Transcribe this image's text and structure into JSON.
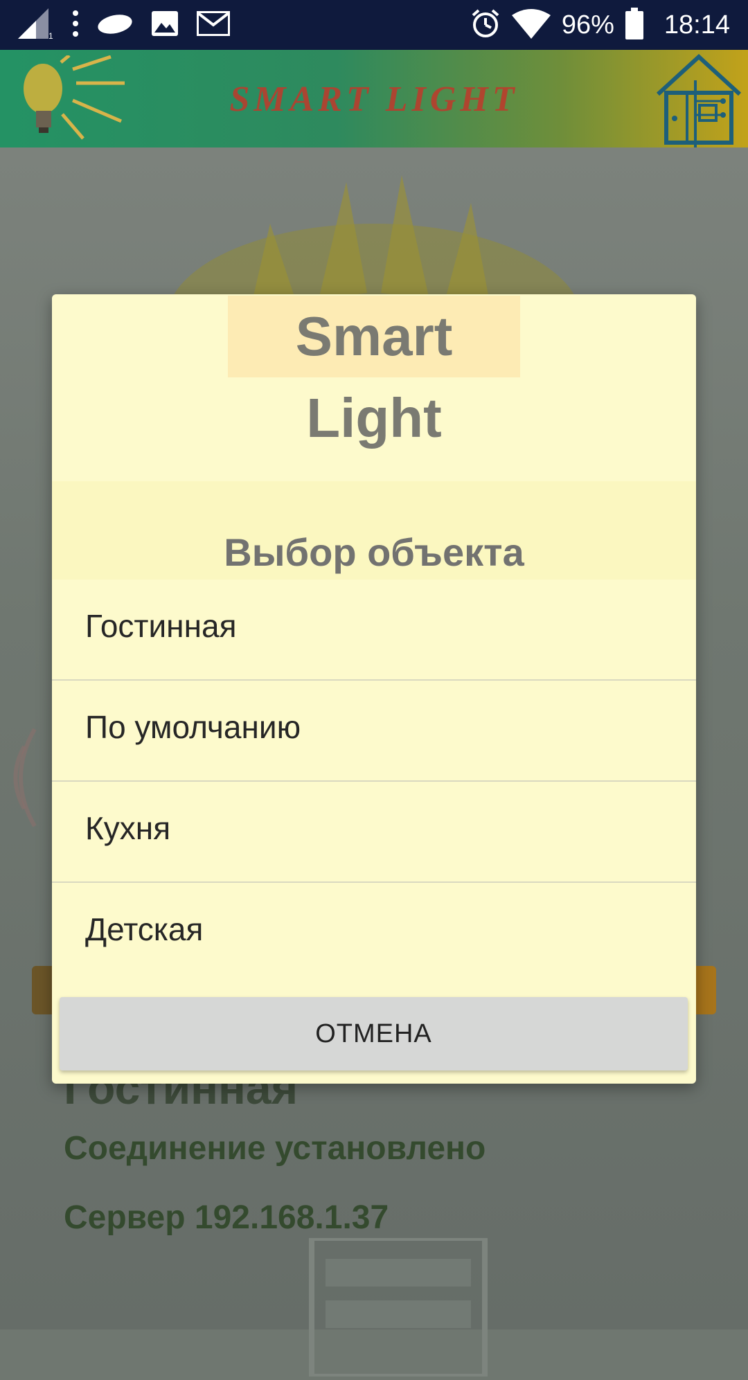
{
  "status_bar": {
    "battery": "96%",
    "time": "18:14"
  },
  "header": {
    "title": "SMART LIGHT"
  },
  "background": {
    "room": "Гостинная",
    "connection_status": "Соединение установлено",
    "server": "Сервер 192.168.1.37"
  },
  "dialog": {
    "title": "Smart Light",
    "subtitle": "Выбор объекта",
    "options": [
      {
        "label": "Гостинная"
      },
      {
        "label": "По умолчанию"
      },
      {
        "label": "Кухня"
      },
      {
        "label": "Детская"
      }
    ],
    "cancel_label": "ОТМЕНА"
  }
}
